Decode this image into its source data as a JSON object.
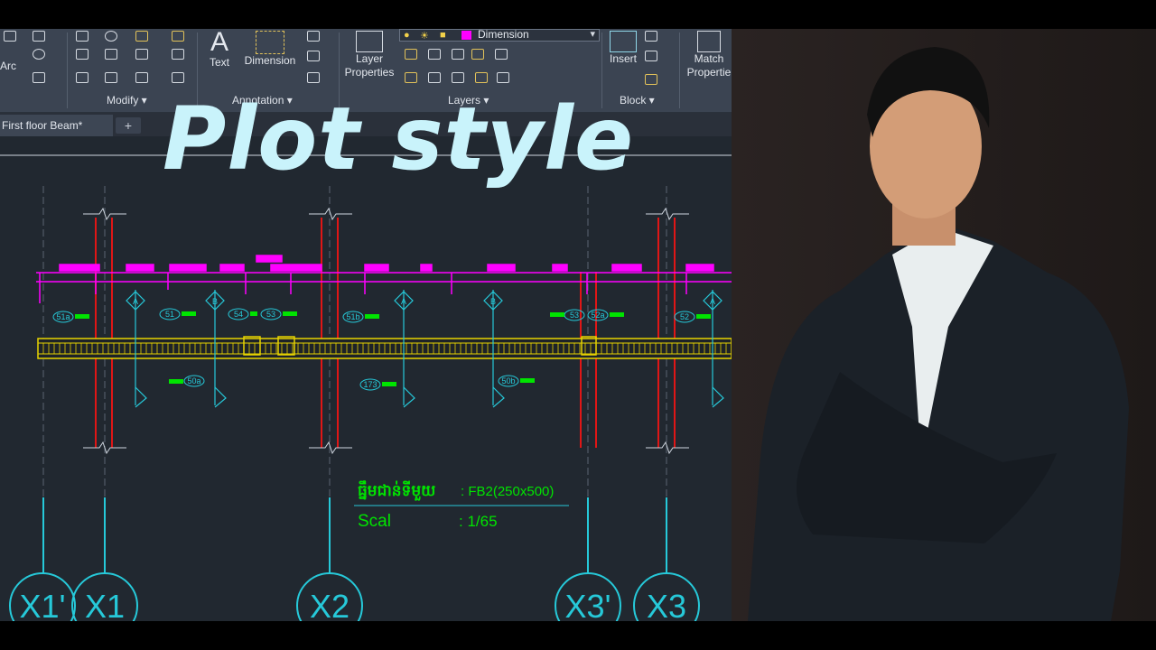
{
  "thumbnail_title": "Plot style",
  "ribbon": {
    "draw_partial_label": "Arc",
    "text_label": "Text",
    "dimension_label": "Dimension",
    "layer_properties_label": "Layer\nProperties",
    "insert_label": "Insert",
    "match_properties_label": "Match\nPropertie",
    "panels": {
      "modify": "Modify",
      "annotation": "Annotation",
      "layers": "Layers",
      "block": "Block"
    },
    "current_layer": "Dimension",
    "current_layer_color": "#ff00ff"
  },
  "document_tab": {
    "label": "First floor Beam*",
    "new_tab_label": "+"
  },
  "drawing": {
    "beam_title_khmer": "ធ្នឹមជាន់ទីមួយ",
    "beam_title_value": ": FB2(250x500)",
    "scale_label": "Scal",
    "scale_value": ": 1/65",
    "grid_bubbles": [
      "X1'",
      "X1",
      "X2",
      "X3'",
      "X3"
    ],
    "section_marks": [
      "A",
      "B",
      "A",
      "B",
      "A"
    ],
    "rebar_tags_top": [
      "51a",
      "51",
      "54",
      "53",
      "51b",
      "53",
      "52a",
      "52"
    ],
    "rebar_tags_bottom": [
      "50a",
      "173",
      "50b"
    ],
    "colors": {
      "background": "#212830",
      "grid_lines": "#26c9d9",
      "beam": "#e8d400",
      "dimensions": "#ff00ff",
      "columns": "#e01616",
      "rebar_tags": "#00e400",
      "title_text": "#c9f3fb"
    }
  }
}
